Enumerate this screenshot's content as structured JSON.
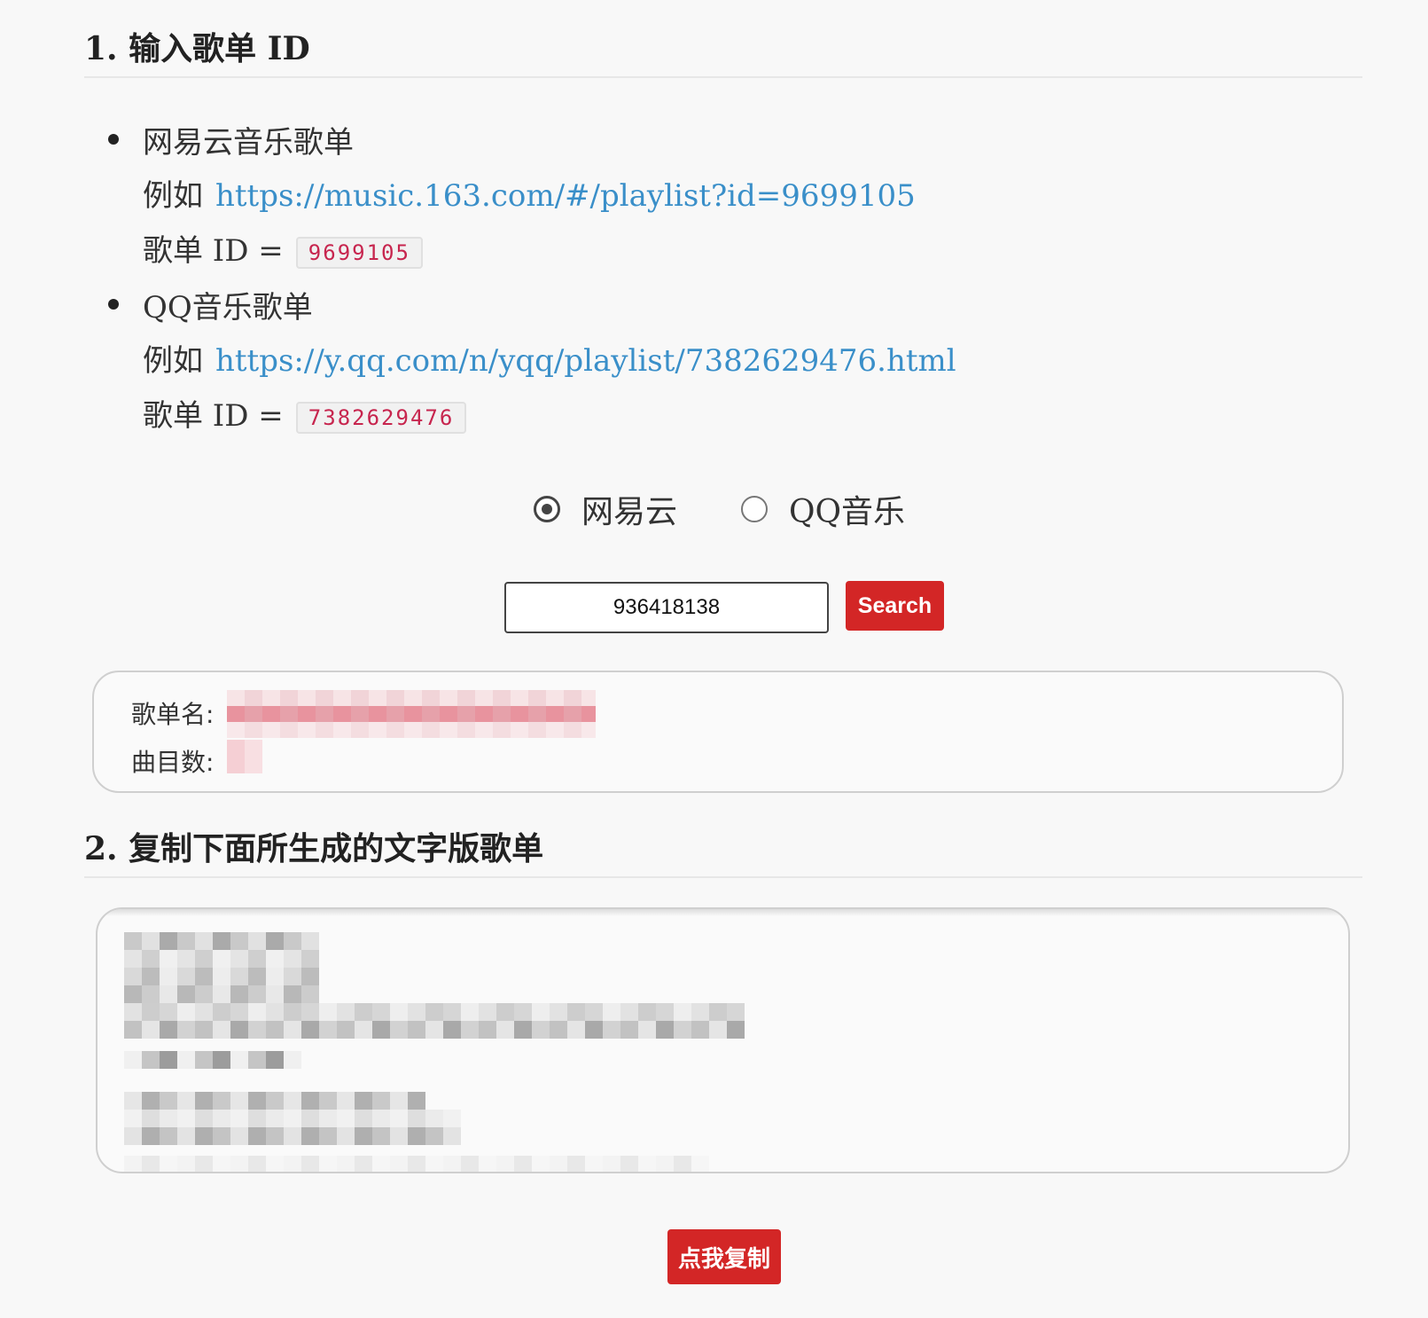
{
  "section1": {
    "title": "1. 输入歌单 ID",
    "items": [
      {
        "name": "网易云音乐歌单",
        "example_prefix": "例如",
        "example_url": "https://music.163.com/#/playlist?id=9699105",
        "id_prefix": "歌单 ID =",
        "id_value": "9699105"
      },
      {
        "name": "QQ音乐歌单",
        "example_prefix": "例如",
        "example_url": "https://y.qq.com/n/yqq/playlist/7382629476.html",
        "id_prefix": "歌单 ID =",
        "id_value": "7382629476"
      }
    ]
  },
  "source": {
    "options": [
      {
        "label": "网易云",
        "checked": true
      },
      {
        "label": "QQ音乐",
        "checked": false
      }
    ]
  },
  "search": {
    "input_value": "936418138",
    "button_label": "Search"
  },
  "info": {
    "name_label": "歌单名:",
    "count_label": "曲目数:"
  },
  "section2": {
    "title": "2. 复制下面所生成的文字版歌单"
  },
  "copy": {
    "button_label": "点我复制"
  },
  "colors": {
    "accent": "#d32626",
    "link": "#3a8fc9",
    "code_text": "#c7254e",
    "background": "#f8f8f8"
  }
}
